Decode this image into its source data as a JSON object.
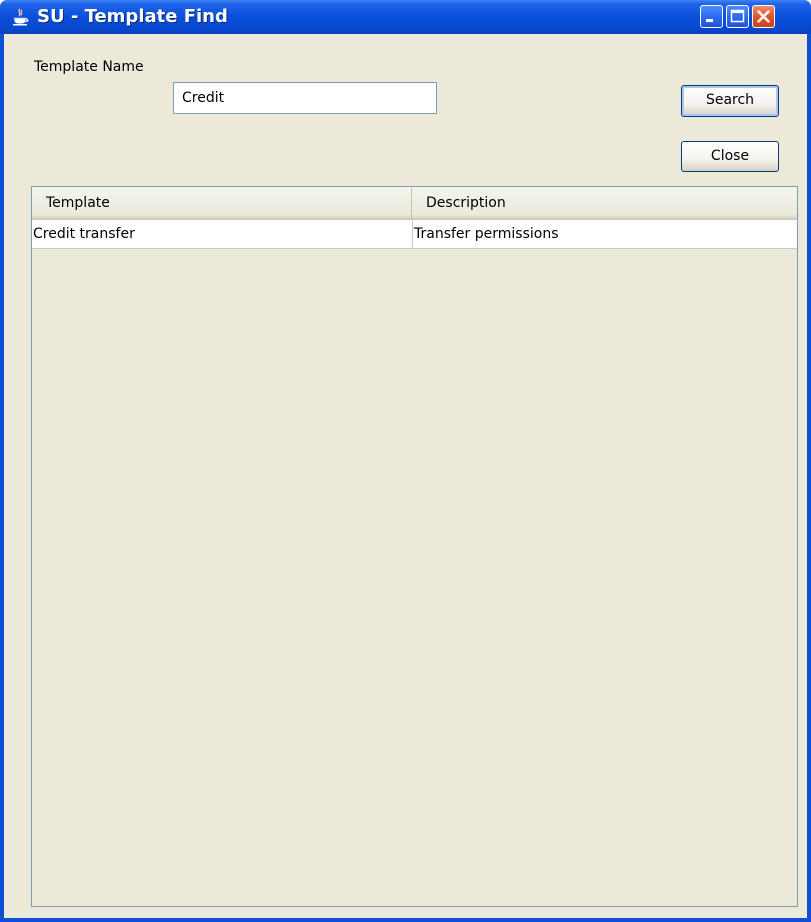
{
  "window": {
    "title": "SU - Template Find",
    "colors": {
      "titlebar": "#0a4fd9",
      "client_bg": "#ece9d8",
      "close_button": "#e2542d"
    }
  },
  "form": {
    "template_name_label": "Template Name",
    "template_name_value": "Credit"
  },
  "buttons": {
    "search_label": "Search",
    "close_label": "Close"
  },
  "table": {
    "columns": [
      "Template",
      "Description"
    ],
    "rows": [
      {
        "template": "Credit transfer",
        "description": "Transfer permissions"
      }
    ]
  }
}
